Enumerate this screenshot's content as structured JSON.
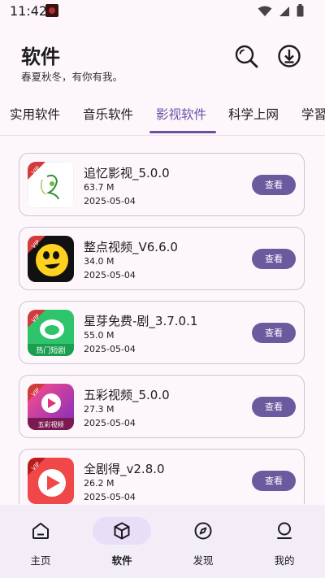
{
  "status_bar": {
    "time": "11:42"
  },
  "header": {
    "title": "软件",
    "subtitle": "春夏秋冬，有你有我。"
  },
  "tabs": [
    {
      "label": "实用软件",
      "active": false
    },
    {
      "label": "音乐软件",
      "active": false
    },
    {
      "label": "影视软件",
      "active": true
    },
    {
      "label": "科学上网",
      "active": false
    },
    {
      "label": "学習",
      "active": false
    }
  ],
  "apps": [
    {
      "name": "追忆影视_5.0.0",
      "size": "63.7 M",
      "date": "2025-05-04",
      "button": "查看",
      "icon_badge": "VIP"
    },
    {
      "name": "整点视频_V6.6.0",
      "size": "34.0 M",
      "date": "2025-05-04",
      "button": "查看",
      "icon_badge": "VIP"
    },
    {
      "name": "星芽免费-剧_3.7.0.1",
      "size": "55.0 M",
      "date": "2025-05-04",
      "button": "查看",
      "icon_badge": "VIP",
      "icon_text": "热门短剧"
    },
    {
      "name": "五彩视频_5.0.0",
      "size": "27.3 M",
      "date": "2025-05-04",
      "button": "查看",
      "icon_badge": "VIP",
      "icon_text": "五彩视频"
    },
    {
      "name": "全剧得_v2.8.0",
      "size": "26.2 M",
      "date": "2025-05-04",
      "button": "查看",
      "icon_badge": "VIP"
    }
  ],
  "bottom_nav": [
    {
      "label": "主页",
      "icon": "home-icon",
      "active": false
    },
    {
      "label": "软件",
      "icon": "box-icon",
      "active": true
    },
    {
      "label": "发现",
      "icon": "compass-icon",
      "active": false
    },
    {
      "label": "我的",
      "icon": "person-icon",
      "active": false
    }
  ],
  "colors": {
    "accent": "#6750a4",
    "button": "#6b5a9e",
    "nav_bg": "#f3edf7",
    "nav_pill": "#e8def8",
    "background": "#fdf7fc"
  }
}
